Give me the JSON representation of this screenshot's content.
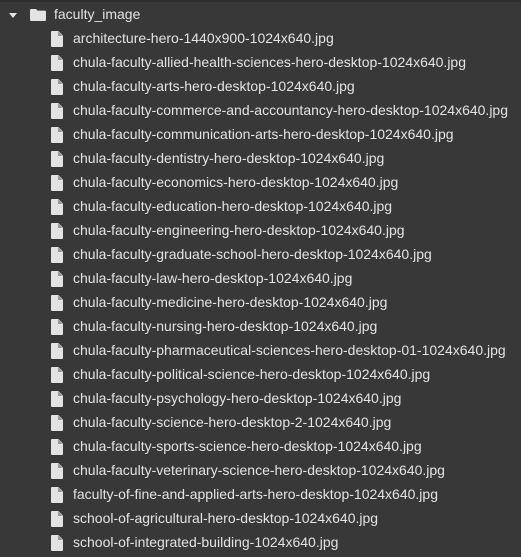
{
  "folder": {
    "name": "faculty_image",
    "icon": "folder-icon",
    "expanded": true
  },
  "files": [
    "architecture-hero-1440x900-1024x640.jpg",
    "chula-faculty-allied-health-sciences-hero-desktop-1024x640.jpg",
    "chula-faculty-arts-hero-desktop-1024x640.jpg",
    "chula-faculty-commerce-and-accountancy-hero-desktop-1024x640.jpg",
    "chula-faculty-communication-arts-hero-desktop-1024x640.jpg",
    "chula-faculty-dentistry-hero-desktop-1024x640.jpg",
    "chula-faculty-economics-hero-desktop-1024x640.jpg",
    "chula-faculty-education-hero-desktop-1024x640.jpg",
    "chula-faculty-engineering-hero-desktop-1024x640.jpg",
    "chula-faculty-graduate-school-hero-desktop-1024x640.jpg",
    "chula-faculty-law-hero-desktop-1024x640.jpg",
    "chula-faculty-medicine-hero-desktop-1024x640.jpg",
    "chula-faculty-nursing-hero-desktop-1024x640.jpg",
    "chula-faculty-pharmaceutical-sciences-hero-desktop-01-1024x640.jpg",
    "chula-faculty-political-science-hero-desktop-1024x640.jpg",
    "chula-faculty-psychology-hero-desktop-1024x640.jpg",
    "chula-faculty-science-hero-desktop-2-1024x640.jpg",
    "chula-faculty-sports-science-hero-desktop-1024x640.jpg",
    "chula-faculty-veterinary-science-hero-desktop-1024x640.jpg",
    "faculty-of-fine-and-applied-arts-hero-desktop-1024x640.jpg",
    "school-of-agricultural-hero-desktop-1024x640.jpg",
    "school-of-integrated-building-1024x640.jpg"
  ],
  "colors": {
    "background": "#383838",
    "text": "#e3e3e3"
  }
}
